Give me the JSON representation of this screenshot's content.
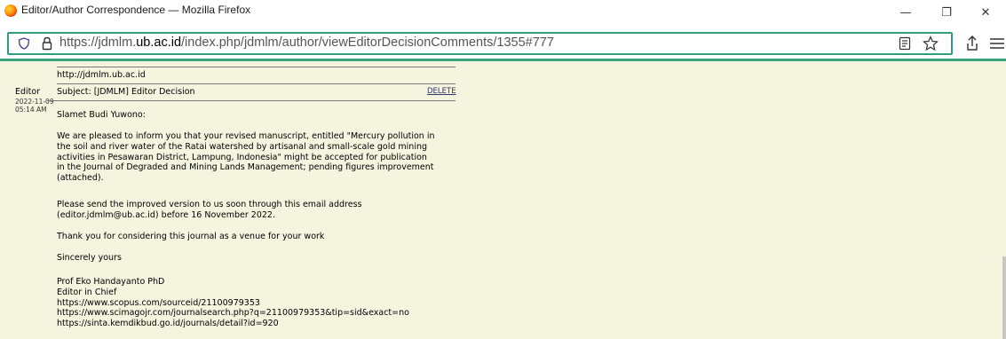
{
  "window": {
    "title": "Editor/Author Correspondence — Mozilla Firefox",
    "controls": {
      "minimize": "—",
      "maximize": "❐",
      "close": "✕"
    }
  },
  "urlbar": {
    "url_prefix": "https://jdmlm.",
    "url_domain": "ub.ac.id",
    "url_path": "/index.php/jdmlm/author/viewEditorDecisionComments/1355#777"
  },
  "icons": {
    "shield": "shield-icon",
    "lock": "lock-icon",
    "reader": "reader-view-icon",
    "star": "bookmark-star-icon",
    "share": "share-icon",
    "menu": "hamburger-menu-icon"
  },
  "message_prev": {
    "url_line": "http://jdmlm.ub.ac.id"
  },
  "message": {
    "sender": "Editor",
    "date": "2022-11-09",
    "time": "05:14 AM",
    "subject": "Subject: [JDMLM] Editor Decision",
    "delete_label": "DELETE",
    "greeting": "Slamet Budi Yuwono:",
    "para1": [
      "We are pleased to inform you that your revised manuscript, entitled \"Mercury pollution in",
      "the soil and river water of the Ratai watershed by artisanal and small-scale gold mining",
      "activities in Pesawaran District, Lampung, Indonesia\" might be accepted for publication",
      "in the Journal of Degraded and Mining Lands Management; pending figures improvement",
      "(attached)."
    ],
    "para2": [
      "Please send the improved version to us soon through this email address",
      "(editor.jdmlm@ub.ac.id) before 16 November 2022."
    ],
    "para3": "Thank you for considering this journal as a venue for your work",
    "closing": "Sincerely yours",
    "signature": [
      "Prof Eko Handayanto PhD",
      "Editor in Chief",
      "https://www.scopus.com/sourceid/21100979353",
      "https://www.scimagojr.com/journalsearch.php?q=21100979353&tip=sid&exact=no",
      "https://sinta.kemdikbud.go.id/journals/detail?id=920"
    ]
  }
}
